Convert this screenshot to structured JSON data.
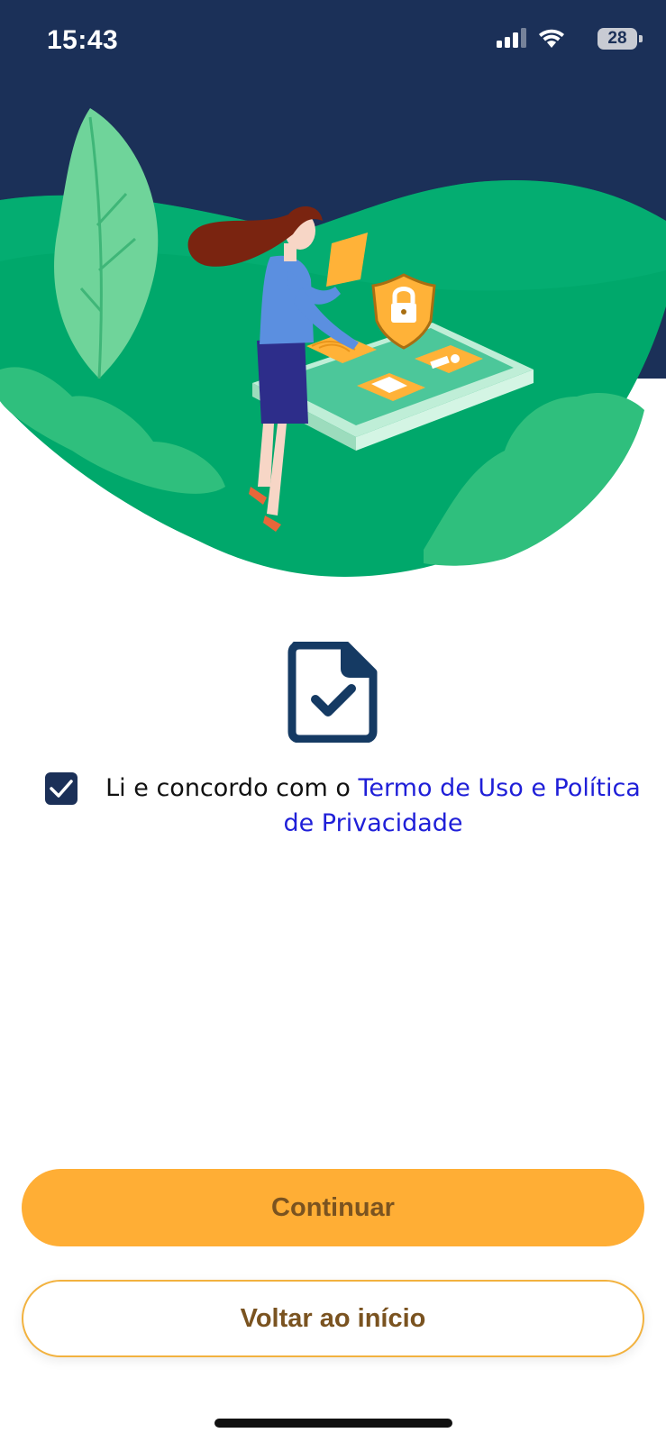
{
  "status_bar": {
    "time": "15:43",
    "battery": "28",
    "icons": [
      "cellular-signal-icon",
      "wifi-icon",
      "battery-icon"
    ]
  },
  "hero": {
    "illustration": "woman with tablet, shield lock, fingerprint, envelope and id card on a large phone",
    "colors": {
      "sky": "#1b3058",
      "hill": "#00a86b",
      "accent": "#ffae35"
    }
  },
  "document_icon": "document-check-icon",
  "agreement": {
    "checked": true,
    "text_prefix": "Li e concordo com o ",
    "link_text": "Termo de Uso e Política de Privacidade"
  },
  "buttons": {
    "continue_label": "Continuar",
    "back_label": "Voltar ao início"
  }
}
